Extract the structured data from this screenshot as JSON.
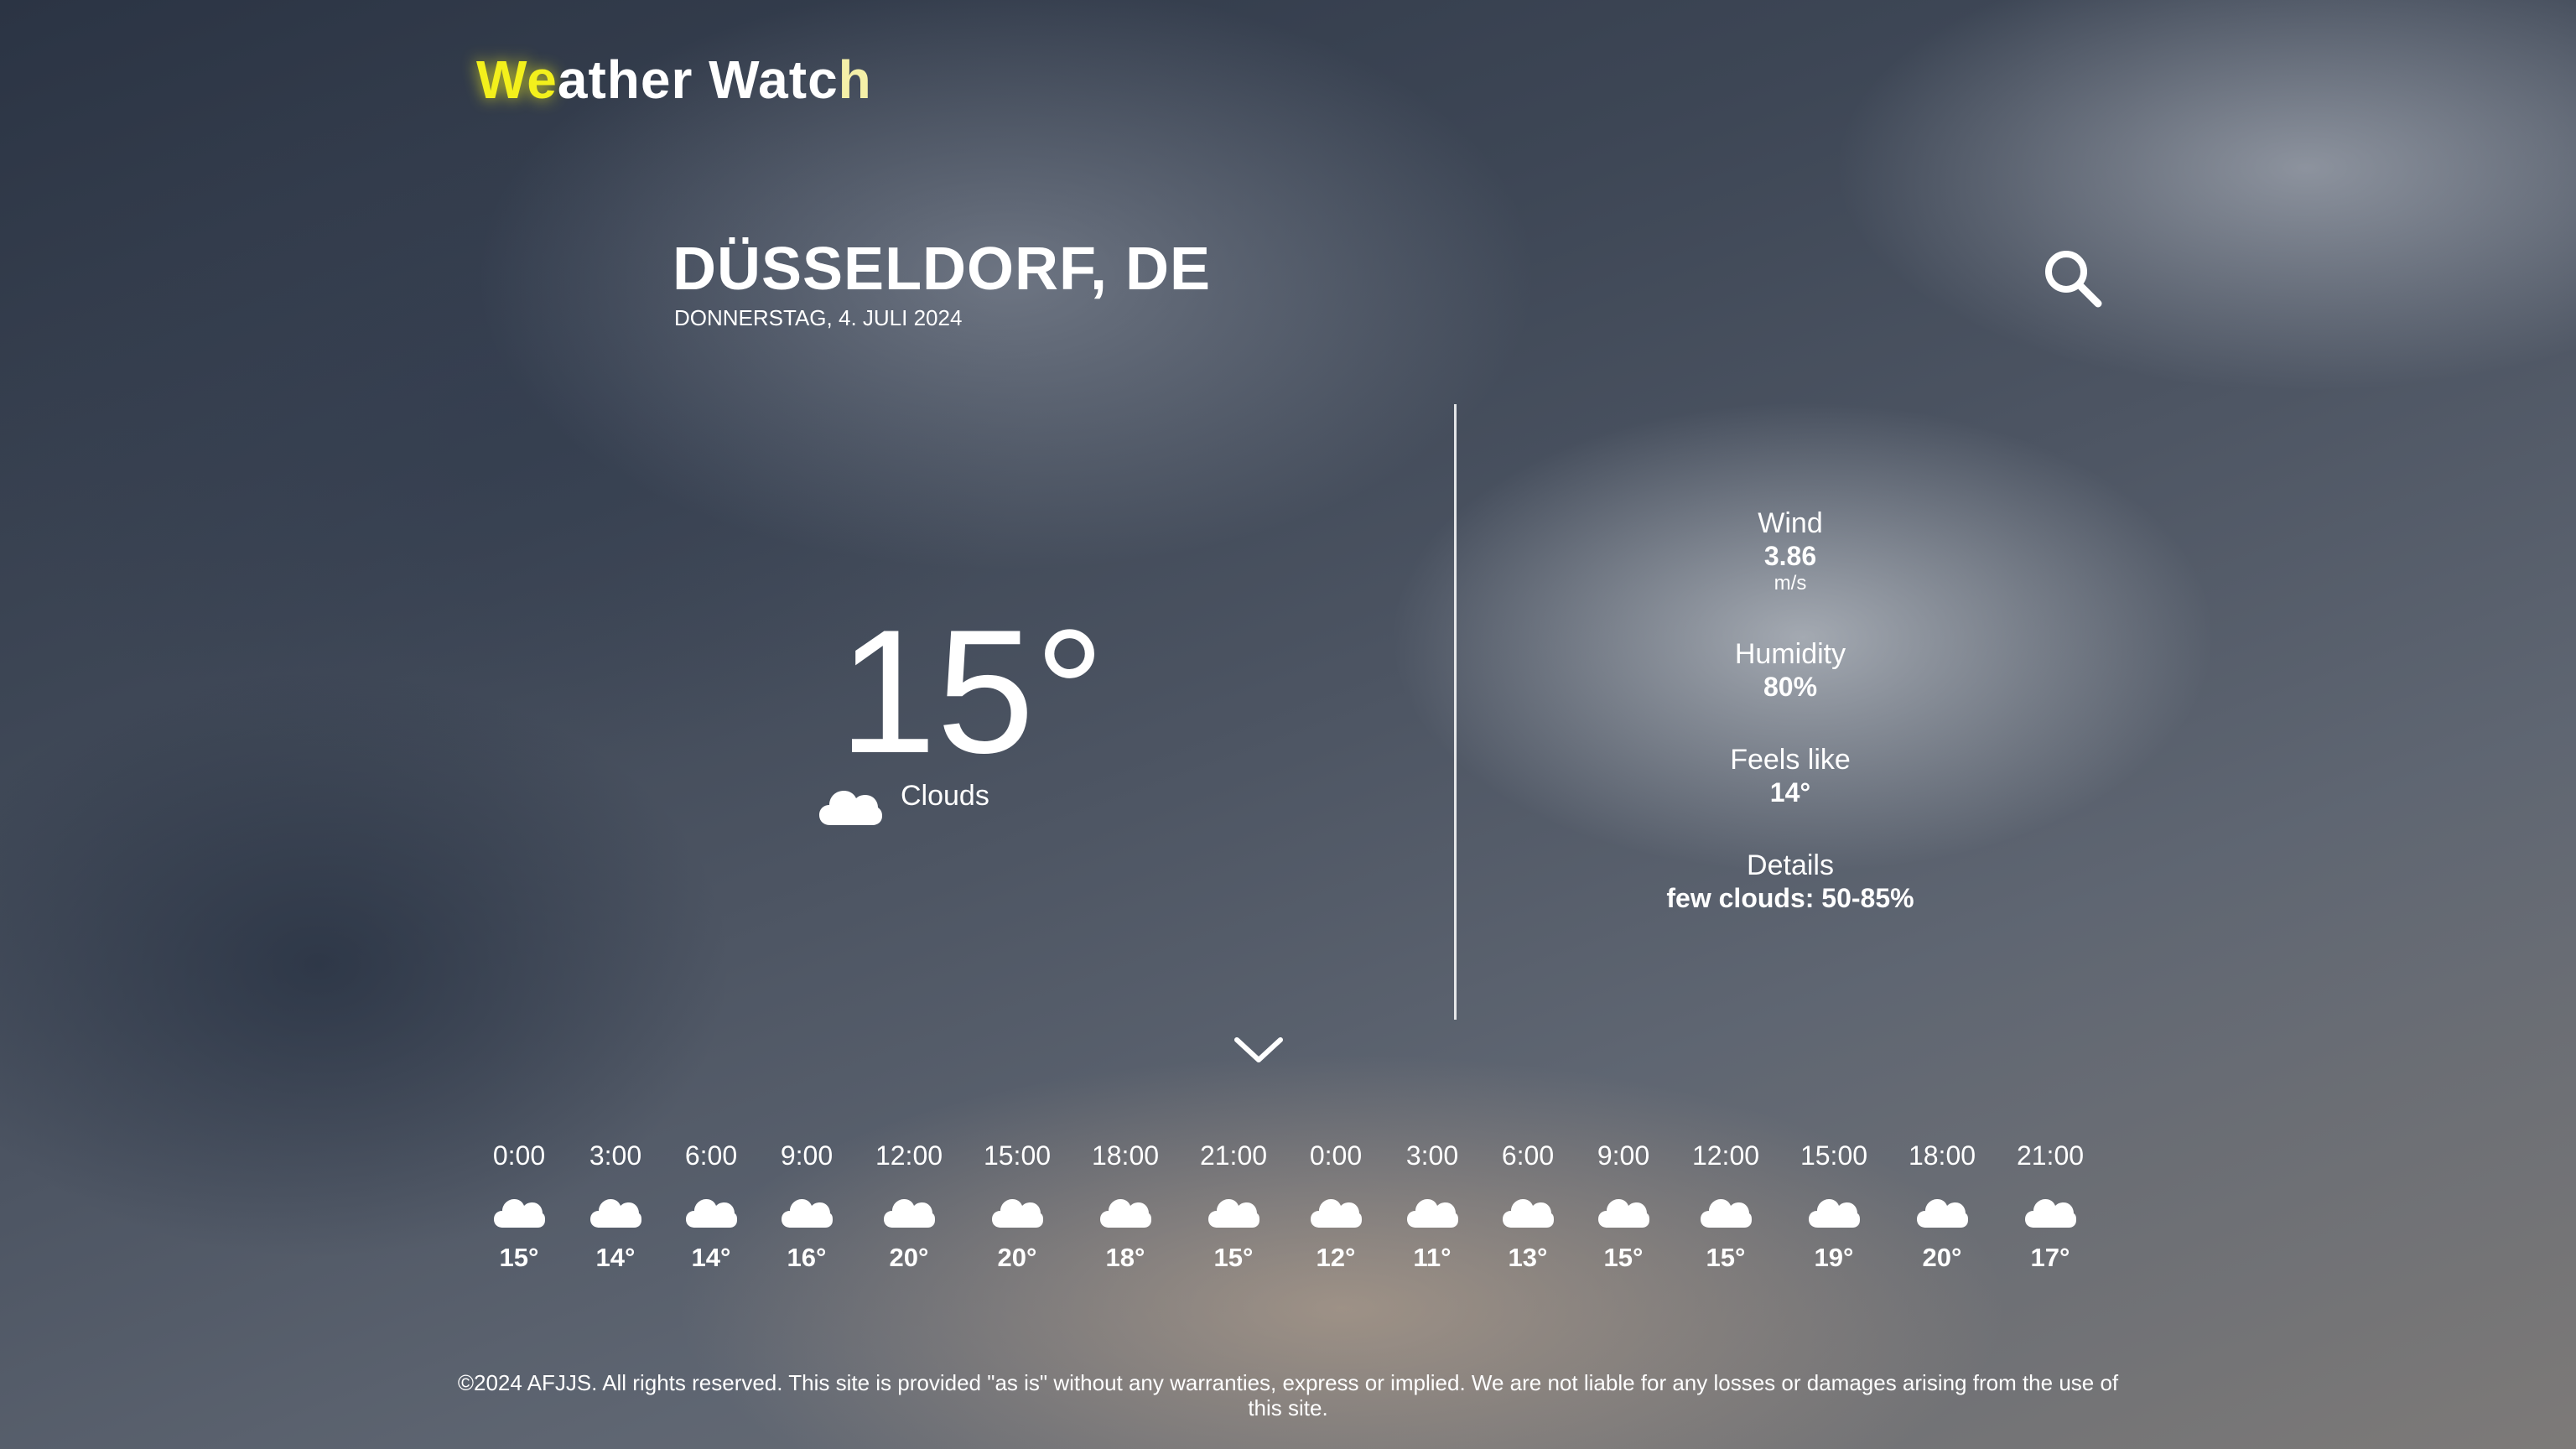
{
  "app": {
    "title_part1": "We",
    "title_part2": "ather Watc",
    "title_part3": "h"
  },
  "location": {
    "city": "DÜSSELDORF, DE",
    "date": "DONNERSTAG, 4. JULI 2024"
  },
  "current": {
    "temperature": "15°",
    "condition": "Clouds",
    "condition_icon": "cloud-icon"
  },
  "details": {
    "wind_label": "Wind",
    "wind_value": "3.86",
    "wind_unit": "m/s",
    "humidity_label": "Humidity",
    "humidity_value": "80%",
    "feels_like_label": "Feels like",
    "feels_like_value": "14°",
    "details_label": "Details",
    "details_value": "few clouds: 50-85%"
  },
  "forecast": [
    {
      "time": "0:00",
      "temp": "15°",
      "icon": "cloud-icon"
    },
    {
      "time": "3:00",
      "temp": "14°",
      "icon": "cloud-icon"
    },
    {
      "time": "6:00",
      "temp": "14°",
      "icon": "cloud-icon"
    },
    {
      "time": "9:00",
      "temp": "16°",
      "icon": "cloud-icon"
    },
    {
      "time": "12:00",
      "temp": "20°",
      "icon": "cloud-icon"
    },
    {
      "time": "15:00",
      "temp": "20°",
      "icon": "cloud-icon"
    },
    {
      "time": "18:00",
      "temp": "18°",
      "icon": "cloud-icon"
    },
    {
      "time": "21:00",
      "temp": "15°",
      "icon": "cloud-icon"
    },
    {
      "time": "0:00",
      "temp": "12°",
      "icon": "cloud-icon"
    },
    {
      "time": "3:00",
      "temp": "11°",
      "icon": "cloud-icon"
    },
    {
      "time": "6:00",
      "temp": "13°",
      "icon": "cloud-icon"
    },
    {
      "time": "9:00",
      "temp": "15°",
      "icon": "cloud-icon"
    },
    {
      "time": "12:00",
      "temp": "15°",
      "icon": "cloud-icon"
    },
    {
      "time": "15:00",
      "temp": "19°",
      "icon": "cloud-icon"
    },
    {
      "time": "18:00",
      "temp": "20°",
      "icon": "cloud-icon"
    },
    {
      "time": "21:00",
      "temp": "17°",
      "icon": "cloud-icon"
    }
  ],
  "footer": {
    "text": "©2024 AFJJS. All rights reserved. This site is provided \"as is\" without any warranties, express or implied. We are not liable for any losses or damages arising from the use of this site."
  },
  "icons": {
    "search": "search-icon",
    "expand": "chevron-down-icon"
  }
}
